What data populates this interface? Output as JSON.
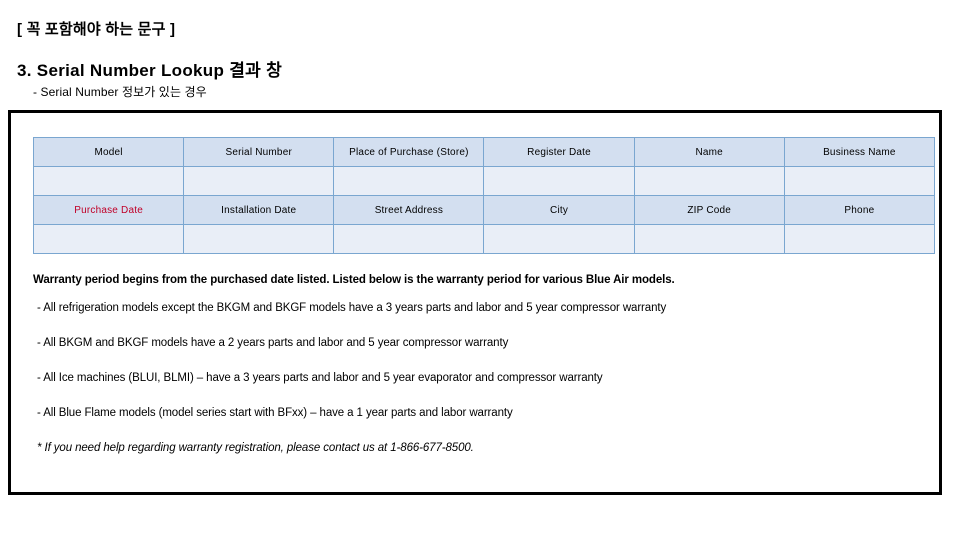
{
  "slide": {
    "heading_bracket": "[ 꼭 포함해야 하는 문구 ]",
    "heading_section": "3. Serial Number Lookup 결과 창",
    "subheading": "- Serial Number 정보가 있는 경우"
  },
  "colors": {
    "table_header_fill": "#d3dff0",
    "table_value_fill": "#e9eef7",
    "table_border": "#7aa6d0",
    "accent_red": "#c00028",
    "panel_border": "#000000"
  },
  "form_table": {
    "row1_labels": [
      "Model",
      "Serial Number",
      "Place of Purchase (Store)",
      "Register Date",
      "Name",
      "Business Name"
    ],
    "row2_values": [
      "",
      "",
      "",
      "",
      "",
      ""
    ],
    "row3_labels": [
      "Purchase Date",
      "Installation Date",
      "Street Address",
      "City",
      "ZIP Code",
      "Phone"
    ],
    "row4_values": [
      "",
      "",
      "",
      "",
      "",
      ""
    ]
  },
  "warranty": {
    "lead": "Warranty period begins from the purchased date listed.  Listed below is the warranty period for various Blue Air models.",
    "bullets": [
      "- All refrigeration models except the BKGM and BKGF models have a 3 years parts and labor and 5 year compressor warranty",
      "- All BKGM and BKGF models have a 2 years parts and labor and 5 year compressor warranty",
      "- All Ice machines (BLUI, BLMI) – have a 3 years parts and labor and 5 year evaporator and compressor warranty",
      "- All Blue Flame models (model series start with BFxx) – have a 1 year parts and labor warranty"
    ],
    "footnote": "* If you need help regarding warranty registration, please contact us at 1-866-677-8500."
  }
}
